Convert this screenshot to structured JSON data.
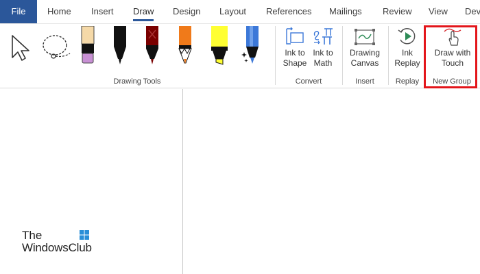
{
  "tabs": [
    {
      "label": "File"
    },
    {
      "label": "Home"
    },
    {
      "label": "Insert"
    },
    {
      "label": "Draw"
    },
    {
      "label": "Design"
    },
    {
      "label": "Layout"
    },
    {
      "label": "References"
    },
    {
      "label": "Mailings"
    },
    {
      "label": "Review"
    },
    {
      "label": "View"
    },
    {
      "label": "Dev"
    }
  ],
  "active_tab": "Draw",
  "ribbon": {
    "groups": {
      "drawing_tools": "Drawing Tools",
      "convert": "Convert",
      "insert": "Insert",
      "replay": "Replay",
      "new_group": "New Group"
    },
    "buttons": {
      "ink_to_shape": [
        "Ink to",
        "Shape"
      ],
      "ink_to_math": [
        "Ink to",
        "Math"
      ],
      "drawing_canvas": [
        "Drawing",
        "Canvas"
      ],
      "ink_replay": [
        "Ink",
        "Replay"
      ],
      "draw_with_touch": [
        "Draw with",
        "Touch"
      ]
    },
    "pens": [
      {
        "icon": "pen-icon",
        "color": "#f5d9a8",
        "tip": "#c27ac9"
      },
      {
        "icon": "pen-icon",
        "color": "#111111",
        "tip": "#111111"
      },
      {
        "icon": "pen-icon",
        "color": "#7a0000",
        "tip": "#7a0000"
      },
      {
        "icon": "pencil-icon",
        "color": "#f07a1a",
        "tip": "#f07a1a"
      },
      {
        "icon": "highlighter-icon",
        "color": "#ffff33",
        "tip": "#ffff33"
      },
      {
        "icon": "action-pen-icon",
        "color": "#3c78d8",
        "tip": "#3c78d8"
      }
    ]
  },
  "accent_color": "#2b579a",
  "highlight_color": "#e3151a",
  "watermark": {
    "line1": "The",
    "line2": "WindowsClub"
  }
}
